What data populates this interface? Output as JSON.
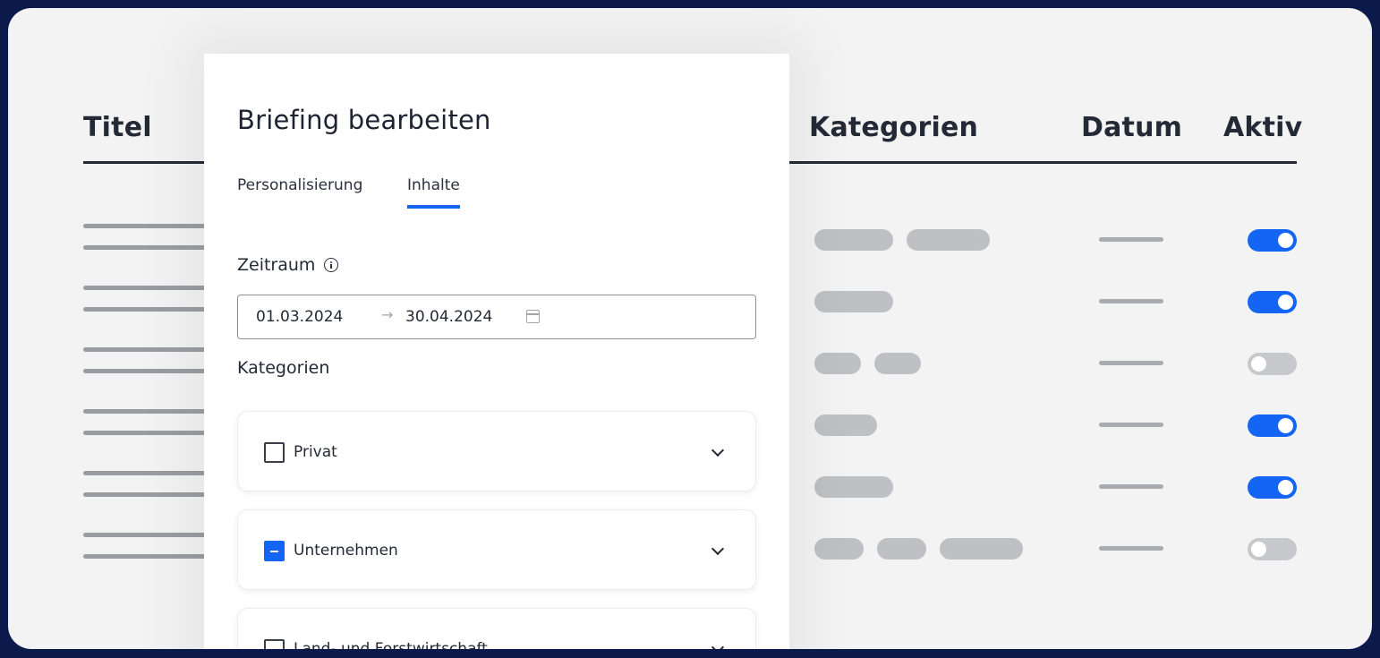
{
  "table": {
    "headers": {
      "titel": "Titel",
      "kategorien": "Kategorien",
      "datum": "Datum",
      "aktiv": "Aktiv"
    },
    "rows": [
      {
        "pills": [
          88,
          93
        ],
        "active": true
      },
      {
        "pills": [
          88
        ],
        "active": true
      },
      {
        "pills": [
          52,
          52
        ],
        "active": false
      },
      {
        "pills": [
          70
        ],
        "active": true
      },
      {
        "pills": [
          88
        ],
        "active": true
      },
      {
        "pills": [
          55,
          55,
          93
        ],
        "active": false
      }
    ]
  },
  "modal": {
    "title": "Briefing bearbeiten",
    "tabs": [
      {
        "label": "Personalisierung",
        "active": false
      },
      {
        "label": "Inhalte",
        "active": true
      }
    ],
    "zeitraum": {
      "label": "Zeitraum",
      "start": "01.03.2024",
      "end": "30.04.2024",
      "arrow": "→"
    },
    "kategorien": {
      "label": "Kategorien",
      "items": [
        {
          "label": "Privat",
          "state": "unchecked"
        },
        {
          "label": "Unternehmen",
          "state": "indeterminate"
        },
        {
          "label": "Land- und Forstwirtschaft",
          "state": "unchecked"
        }
      ]
    }
  },
  "colors": {
    "accent": "#1565f5",
    "frame": "#0b1a4a",
    "background": "#f3f3f4"
  }
}
